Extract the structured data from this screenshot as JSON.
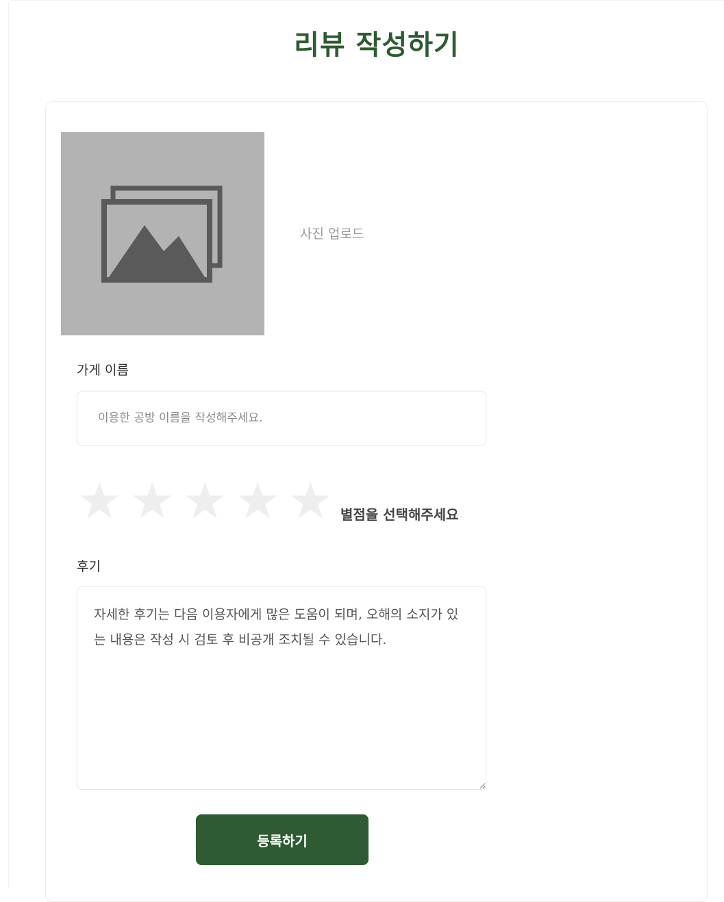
{
  "page": {
    "title": "리뷰 작성하기"
  },
  "photo": {
    "icon": "image-gallery-icon",
    "upload_label": "사진 업로드"
  },
  "store": {
    "label": "가게 이름",
    "placeholder": "이용한 공방 이름을 작성해주세요.",
    "value": ""
  },
  "rating": {
    "stars": [
      "★",
      "★",
      "★",
      "★",
      "★"
    ],
    "selected": 0,
    "max": 5,
    "hint": "별점을 선택해주세요",
    "empty_color": "#eeeeee"
  },
  "review": {
    "label": "후기",
    "placeholder": "자세한 후기는 다음 이용자에게 많은 도움이 되며, 오해의 소지가 있는 내용은 작성 시 검토 후 비공개 조치될 수 있습니다.",
    "value": ""
  },
  "submit": {
    "label": "등록하기"
  },
  "colors": {
    "accent": "#2e5b31",
    "photo_placeholder_bg": "#b3b3b3",
    "icon_color": "#5a5a5a"
  }
}
